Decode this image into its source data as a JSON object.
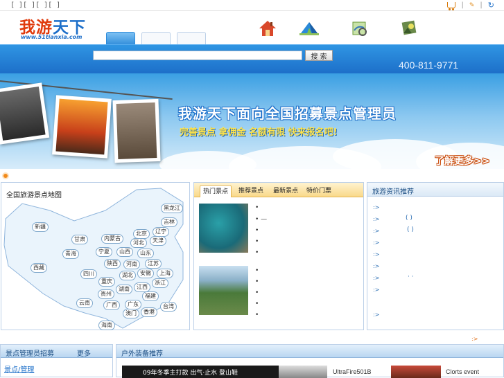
{
  "topbar": {
    "left_links": "[ ][ ][ ][ ]",
    "right_seps": [
      "|",
      "|"
    ]
  },
  "logo": {
    "cn_part1": "我游",
    "cn_part2": "天下",
    "url": "www.51tianxia.com"
  },
  "nav": {
    "icons": [
      "home-icon",
      "tent-icon",
      "map-icon",
      "guide-icon"
    ]
  },
  "search": {
    "value": "",
    "placeholder": "",
    "button_label": "搜 索"
  },
  "phone": "400-811-9771",
  "banner": {
    "title": "我游天下面向全国招募景点管理员",
    "subtitle": "完善景点 拿佣金 名额有限 快来报名吧!",
    "more": "了解更多>>"
  },
  "map_panel": {
    "title": "全国旅游景点地图",
    "provinces": [
      "黑龙江",
      "吉林",
      "辽宁",
      "北京",
      "天津",
      "内蒙古",
      "河北",
      "山西",
      "山东",
      "宁夏",
      "甘肃",
      "新疆",
      "青海",
      "西藏",
      "陕西",
      "河南",
      "江苏",
      "安徽",
      "上海",
      "湖北",
      "浙江",
      "四川",
      "重庆",
      "湖南",
      "江西",
      "福建",
      "贵州",
      "云南",
      "广西",
      "广东",
      "澳门",
      "香港",
      "台湾",
      "海南"
    ]
  },
  "mid_panel": {
    "tabs": [
      "热门景点",
      "推荐景点",
      "最新景点",
      "特价门票"
    ],
    "list_a": [
      "•",
      "• —",
      "•",
      "•",
      "•"
    ],
    "list_b": [
      "•",
      "•",
      "•",
      "•",
      "•"
    ]
  },
  "right_panel": {
    "title": "旅游资讯推荐",
    "arrows": [
      ":>",
      ":>",
      ":>",
      ":>",
      ":>",
      ":>",
      ":>",
      ":>",
      ":>"
    ],
    "paren1": "( )",
    "paren2": "( )",
    "dots": "· ·"
  },
  "bottom_left": {
    "title": "景点管理员招募",
    "title2": "更多",
    "link": "景点/管理"
  },
  "bottom_right": {
    "title": "户外装备推荐",
    "more_arrow": ":>",
    "products": [
      "09年冬季主打款 出气·止水 登山鞋",
      "UltraFire501B",
      "Clorts event"
    ]
  },
  "colors": {
    "brand_blue": "#1d6fc9",
    "brand_orange": "#e03a0c",
    "accent_yellow": "#ffe34a"
  }
}
